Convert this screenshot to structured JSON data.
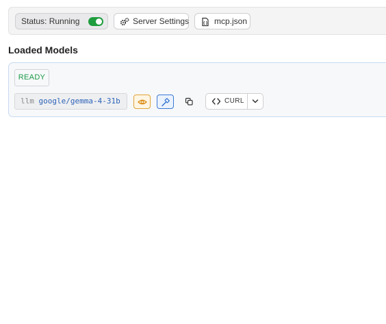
{
  "toolbar": {
    "status_label": "Status: Running",
    "status_on": true,
    "server_settings_label": "Server Settings",
    "mcp_label": "mcp.json"
  },
  "section": {
    "title": "Loaded Models"
  },
  "models": [
    {
      "state": "READY",
      "type": "llm",
      "name": "google/gemma-4-31b",
      "capabilities": [
        "vision",
        "tool-use"
      ],
      "curl_label": "CURL"
    }
  ],
  "colors": {
    "toggle_on": "#1f9d3f",
    "ready_text": "#1a9a45",
    "model_name": "#2c62b8",
    "vision_accent": "#e0a236",
    "tools_accent": "#3a78d4",
    "card_border": "#c7daf2"
  },
  "icons": {
    "server_settings": "gears-icon",
    "mcp": "json-file-icon",
    "vision": "eye-icon",
    "tools": "hammer-icon",
    "copy": "copy-icon",
    "curl": "code-brackets-icon",
    "dropdown": "chevron-down-icon"
  }
}
